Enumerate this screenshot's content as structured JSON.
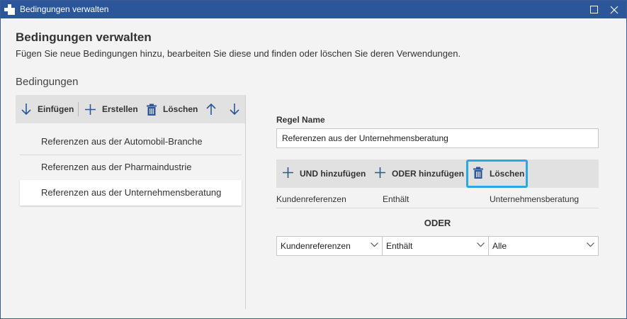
{
  "window": {
    "title": "Bedingungen verwalten"
  },
  "header": {
    "title": "Bedingungen verwalten",
    "subtitle": "Fügen Sie neue Bedingungen hinzu, bearbeiten Sie diese und finden oder löschen Sie deren Verwendungen."
  },
  "left_panel": {
    "section_title": "Bedingungen",
    "toolbar": {
      "insert_label": "Einfügen",
      "create_label": "Erstellen",
      "delete_label": "Löschen"
    },
    "rules": [
      {
        "label": "Referenzen aus der Automobil-Branche",
        "selected": false
      },
      {
        "label": "Referenzen aus der Pharmaindustrie",
        "selected": false
      },
      {
        "label": "Referenzen aus der Unternehmensberatung",
        "selected": true
      }
    ]
  },
  "right_panel": {
    "rule_name_label": "Regel Name",
    "rule_name_value": "Referenzen aus der Unternehmensberatung",
    "toolbar": {
      "and_add_label": "UND hinzufügen",
      "or_add_label": "ODER hinzufügen",
      "delete_label": "Löschen"
    },
    "condition": {
      "field": "Kundenreferenzen",
      "operator": "Enthält",
      "value": "Unternehmensberatung"
    },
    "or_label": "ODER",
    "new_condition": {
      "field": "Kundenreferenzen",
      "operator": "Enthält",
      "value": "Alle"
    }
  },
  "colors": {
    "titlebar": "#2b579a",
    "accent_icon": "#2b579a",
    "highlight_border": "#29a9e0"
  }
}
